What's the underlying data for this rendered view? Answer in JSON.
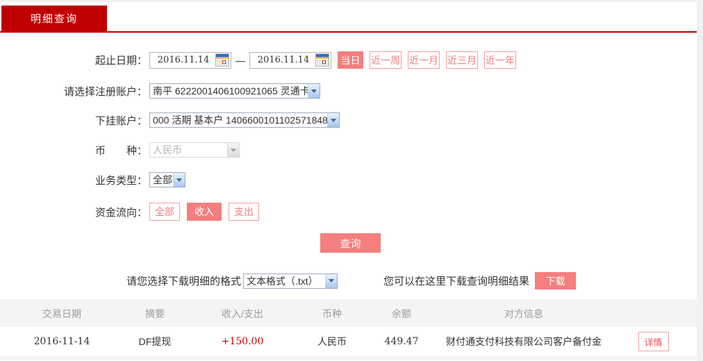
{
  "tab": {
    "label": "明细查询"
  },
  "form": {
    "date_range": {
      "label": "起止日期：",
      "start_value": "2016.11.14",
      "end_value": "2016.11.14",
      "separator": "—",
      "quick_ranges": [
        {
          "label": "当日",
          "active": true
        },
        {
          "label": "近一周",
          "active": false
        },
        {
          "label": "近一月",
          "active": false
        },
        {
          "label": "近三月",
          "active": false
        },
        {
          "label": "近一年",
          "active": false
        }
      ]
    },
    "register_account": {
      "label": "请选择注册账户：",
      "selected": "南平 6222001406100921065 灵通卡"
    },
    "sub_account": {
      "label": "下挂账户：",
      "selected": "000 活期 基本户 1406600101102571848"
    },
    "currency": {
      "label": "币　　种：",
      "selected": "人民币",
      "disabled": true
    },
    "business_type": {
      "label": "业务类型：",
      "selected": "全部"
    },
    "fund_flow": {
      "label": "资金流向：",
      "options": [
        {
          "label": "全部",
          "active": false
        },
        {
          "label": "收入",
          "active": true
        },
        {
          "label": "支出",
          "active": false
        }
      ]
    },
    "query_button_label": "查询"
  },
  "download": {
    "format_label": "请您选择下载明细的格式",
    "format_selected": "文本格式（.txt）",
    "hint": "您可以在这里下载查询明细结果",
    "button_label": "下载"
  },
  "table": {
    "headers": [
      "交易日期",
      "摘要",
      "收入/支出",
      "币种",
      "余额",
      "对方信息"
    ],
    "rows": [
      {
        "date": "2016-11-14",
        "summary": "DF提现",
        "amount": "+150.00",
        "currency": "人民币",
        "balance": "449.47",
        "counterparty": "财付通支付科技有限公司客户备付金",
        "action_label": "详情"
      }
    ]
  },
  "colors": {
    "brand_red": "#c00000",
    "accent_pink": "#f57e7e",
    "amount_positive": "#cc0000",
    "page_background": "#f1f1f1"
  }
}
